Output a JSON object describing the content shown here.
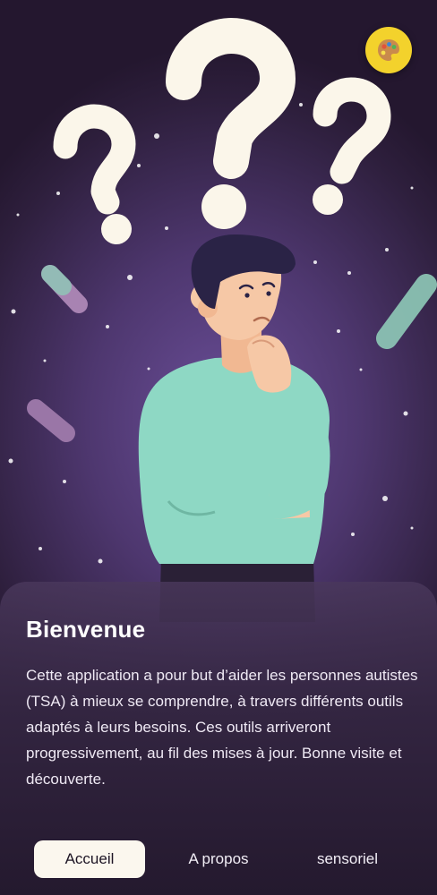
{
  "theme_button": {
    "icon": "palette-icon",
    "color": "#f3d22c"
  },
  "welcome": {
    "title": "Bienvenue",
    "body": "Cette application a pour but d’aider les personnes autistes (TSA) à mieux se comprendre, à travers différents outils adaptés à leurs besoins. Ces outils arriveront progressivement, au fil des mises à jour. Bonne visite et découverte."
  },
  "nav": {
    "tabs": [
      {
        "label": "Accueil",
        "active": true
      },
      {
        "label": "A propos",
        "active": false
      },
      {
        "label": "sensoriel",
        "active": false
      }
    ]
  },
  "colors": {
    "background": "#4e376f",
    "shirt": "#8ed8c4",
    "question_marks": "#fbf6ea",
    "active_tab": "#fbf7ee"
  }
}
